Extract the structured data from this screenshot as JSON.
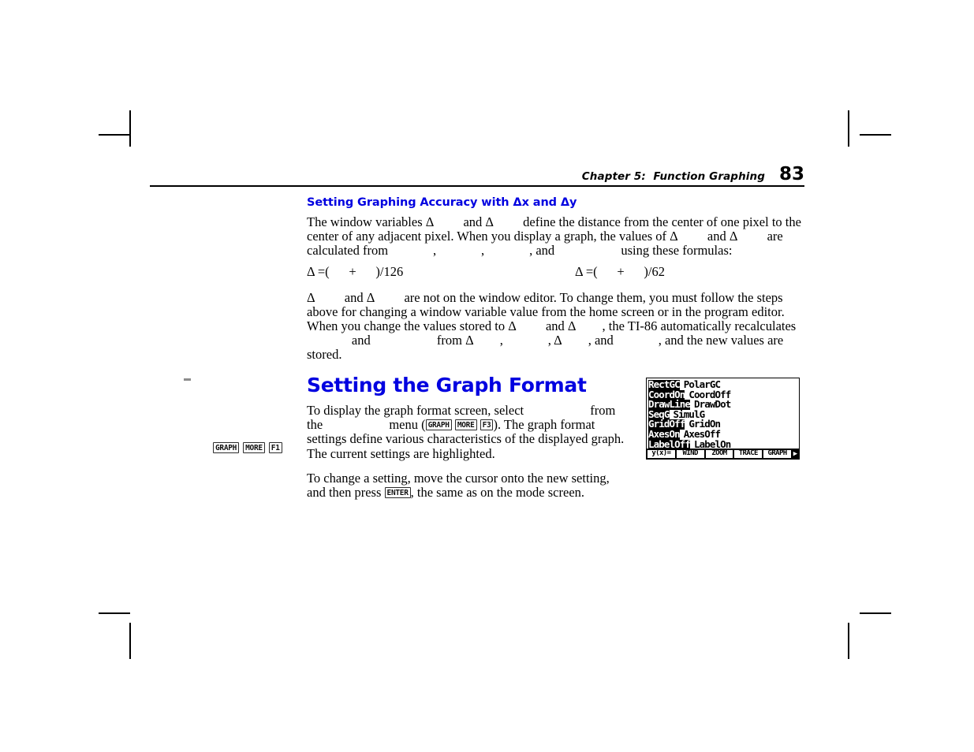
{
  "header": {
    "chapter": "Chapter 5:  Function Graphing",
    "page_number": "83"
  },
  "section_delta": {
    "heading": "Setting Graphing Accuracy with Δx and Δy",
    "para1_a": "The window variables Δ",
    "para1_b": " and Δ",
    "para1_c": " define the distance from the center of one pixel to the center of any adjacent pixel. When you display a graph, the values of Δ",
    "para1_d": " and Δ",
    "para1_e": " are calculated from ",
    "para1_f": ", ",
    "para1_g": ", ",
    "para1_h": ", and ",
    "para1_i": " using these formulas:",
    "formula_left": "Δ =(      +      )/126",
    "formula_right": "Δ =(      +      )/62",
    "para2_a": "Δ",
    "para2_b": " and Δ",
    "para2_c": " are not on the window editor. To change them, you must follow the steps above for changing a window variable value from the home screen or in the program editor. When you change the values stored to Δ",
    "para2_d": " and Δ",
    "para2_e": ", the TI-86 automatically recalculates ",
    "para2_f": " and ",
    "para2_g": " from Δ",
    "para2_h": ", ",
    "para2_i": ", Δ",
    "para2_j": ", and ",
    "para2_k": ", and the new values are stored."
  },
  "section_format": {
    "heading": "Setting the Graph Format",
    "para1_a": "To display the graph format screen, select ",
    "para1_b": " from the ",
    "para1_c": " menu (",
    "para1_d": "). The graph format settings define various characteristics of the displayed graph. The current settings are highlighted.",
    "para2_a": "To change a setting, move the cursor onto the new setting, and then press ",
    "para2_b": ", the same as on the mode screen.",
    "keys_inline": [
      "GRAPH",
      "MORE",
      "F3"
    ],
    "key_enter": "ENTER"
  },
  "margin_keys": [
    "GRAPH",
    "MORE",
    "F1"
  ],
  "lcd": {
    "rows": [
      {
        "left": "RectGC",
        "left_selected": true,
        "right": "PolarGC",
        "right_selected": false
      },
      {
        "left": "CoordOn",
        "left_selected": true,
        "right": "CoordOff",
        "right_selected": false
      },
      {
        "left": "DrawLine",
        "left_selected": true,
        "right": "DrawDot",
        "right_selected": false
      },
      {
        "left": "SeqG",
        "left_selected": true,
        "right": "SimulG",
        "right_selected": false
      },
      {
        "left": "GridOff",
        "left_selected": true,
        "right": "GridOn",
        "right_selected": false
      },
      {
        "left": "AxesOn",
        "left_selected": true,
        "right": "AxesOff",
        "right_selected": false
      },
      {
        "left": "LabelOff",
        "left_selected": true,
        "right": "LabelOn",
        "right_selected": false
      }
    ],
    "menubar": [
      "y(x)=",
      "WIND",
      "ZOOM",
      "TRACE",
      "GRAPH"
    ],
    "menubar_arrow": "▶"
  },
  "colors": {
    "heading_blue": "#0000E0",
    "text_black": "#000000",
    "lcd_background": "#FFFFFF",
    "lcd_ink": "#000000"
  }
}
